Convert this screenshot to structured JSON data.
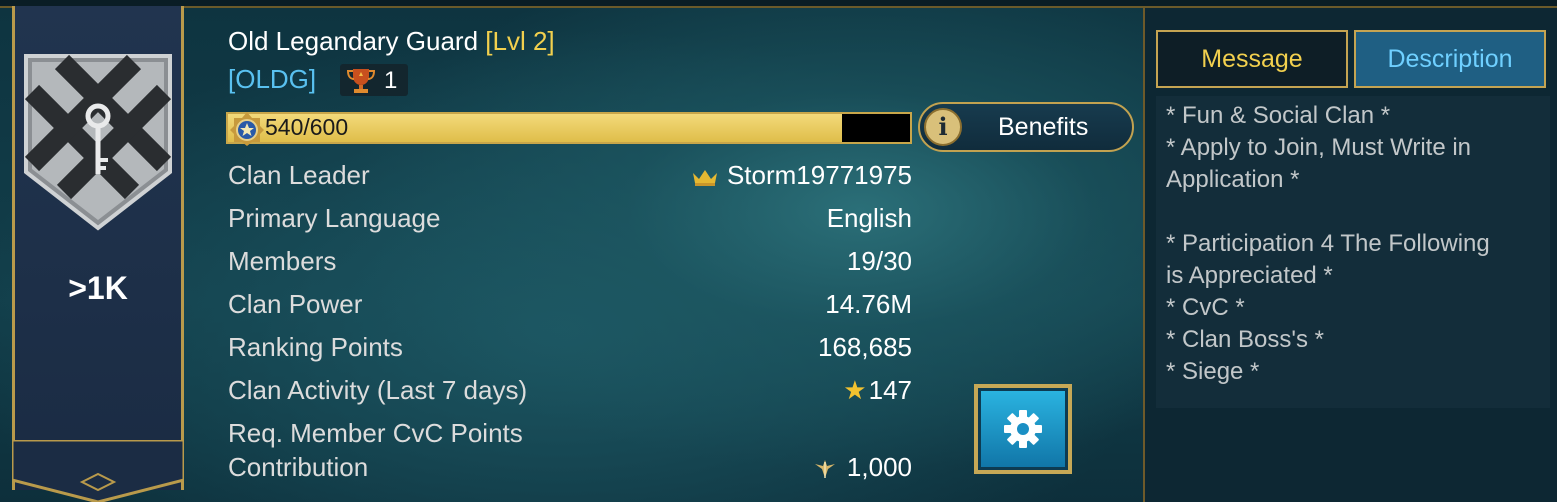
{
  "clan": {
    "name": "Old Legandary Guard",
    "level": "[Lvl 2]",
    "tag": "[OLDG]",
    "trophies": "1",
    "rank_badge": ">1K"
  },
  "xp": {
    "text": "540/600",
    "current": 540,
    "max": 600
  },
  "benefits_button": {
    "label": "Benefits",
    "icon": "info-icon"
  },
  "stats": [
    {
      "label": "Clan Leader",
      "value": "Storm19771975",
      "icon": "crown-icon"
    },
    {
      "label": "Primary Language",
      "value": "English"
    },
    {
      "label": "Members",
      "value": "19/30"
    },
    {
      "label": "Clan Power",
      "value": "14.76M"
    },
    {
      "label": "Ranking Points",
      "value": "168,685"
    },
    {
      "label": "Clan Activity (Last 7 days)",
      "value": "147",
      "icon": "star-icon"
    },
    {
      "label": "Req. Member CvC Points",
      "label2": "Contribution",
      "value": "1,000",
      "icon": "cvc-points-icon"
    }
  ],
  "tabs": {
    "message": "Message",
    "description": "Description",
    "active": "description"
  },
  "description_lines": [
    "* Fun & Social Clan *",
    "* Apply to Join, Must Write in",
    "Application *",
    "",
    "* Participation 4 The Following",
    "is Appreciated *",
    "* CvC *",
    "* Clan Boss's *",
    "* Siege *"
  ],
  "colors": {
    "gold": "#f2d04e",
    "tag_blue": "#59c1f0",
    "xp_fill": "#e6c85a",
    "banner_navy": "#1f3250",
    "active_tab": "#1f5f83"
  }
}
